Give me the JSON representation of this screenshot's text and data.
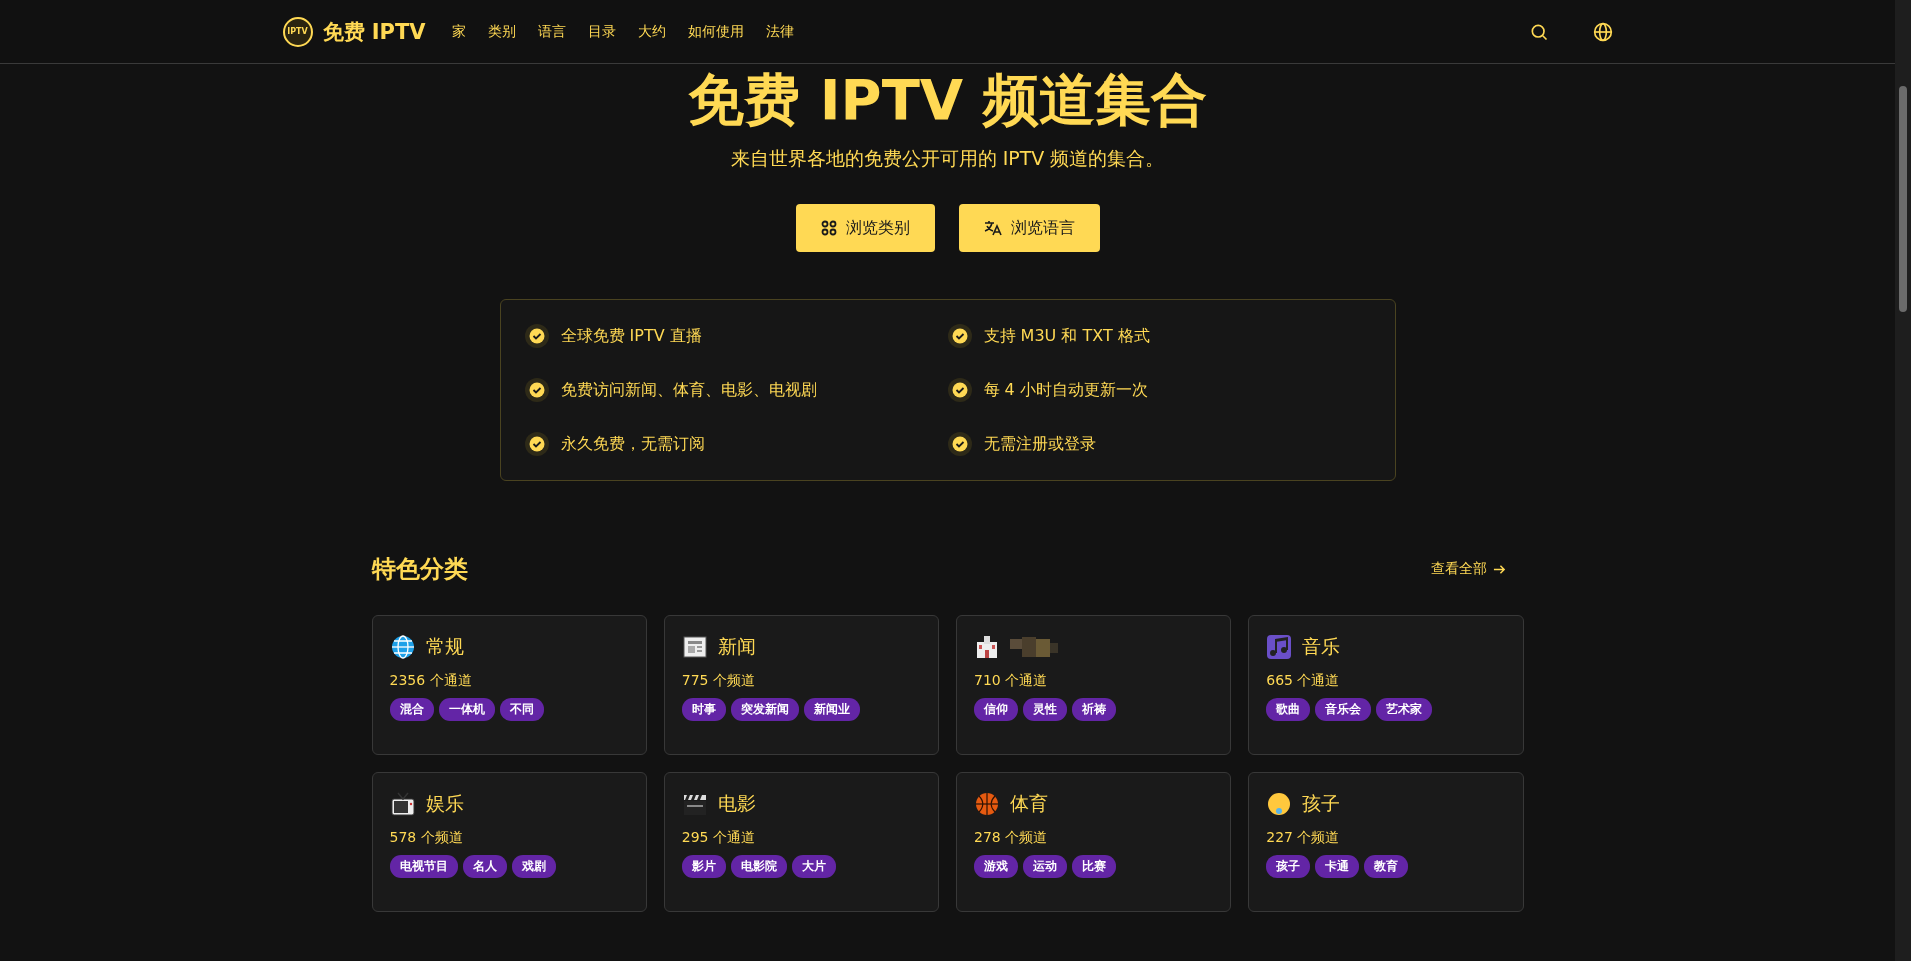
{
  "nav": {
    "brand": "免费 IPTV",
    "logo_text": "IPTV",
    "links": [
      "家",
      "类别",
      "语言",
      "目录",
      "大约",
      "如何使用",
      "法律"
    ]
  },
  "hero": {
    "title": "免费 IPTV 频道集合",
    "subtitle": "来自世界各地的免费公开可用的 IPTV 频道的集合。",
    "buttons": [
      {
        "kind": "grid",
        "label": "浏览类别"
      },
      {
        "kind": "translate",
        "label": "浏览语言"
      }
    ]
  },
  "features": [
    "全球免费 IPTV 直播",
    "支持 M3U 和 TXT 格式",
    "免费访问新闻、体育、电影、电视剧",
    "每 4 小时自动更新一次",
    "永久免费，无需订阅",
    "无需注册或登录"
  ],
  "featured_categories": {
    "title": "特色分类",
    "view_all": "查看全部",
    "cards": [
      {
        "name": "常规",
        "count": "2356 个通道",
        "tags": [
          "混合",
          "一体机",
          "不同"
        ]
      },
      {
        "name": "新闻",
        "count": "775 个频道",
        "tags": [
          "时事",
          "突发新闻",
          "新闻业"
        ]
      },
      {
        "count": "710 个通道",
        "tags": [
          "信仰",
          "灵性",
          "祈祷"
        ]
      },
      {
        "name": "音乐",
        "count": "665 个通道",
        "tags": [
          "歌曲",
          "音乐会",
          "艺术家"
        ]
      },
      {
        "name": "娱乐",
        "count": "578 个频道",
        "tags": [
          "电视节目",
          "名人",
          "戏剧"
        ]
      },
      {
        "name": "电影",
        "count": "295 个通道",
        "tags": [
          "影片",
          "电影院",
          "大片"
        ]
      },
      {
        "name": "体育",
        "count": "278 个频道",
        "tags": [
          "游戏",
          "运动",
          "比赛"
        ]
      },
      {
        "name": "孩子",
        "count": "227 个频道",
        "tags": [
          "孩子",
          "卡通",
          "教育"
        ]
      }
    ]
  }
}
